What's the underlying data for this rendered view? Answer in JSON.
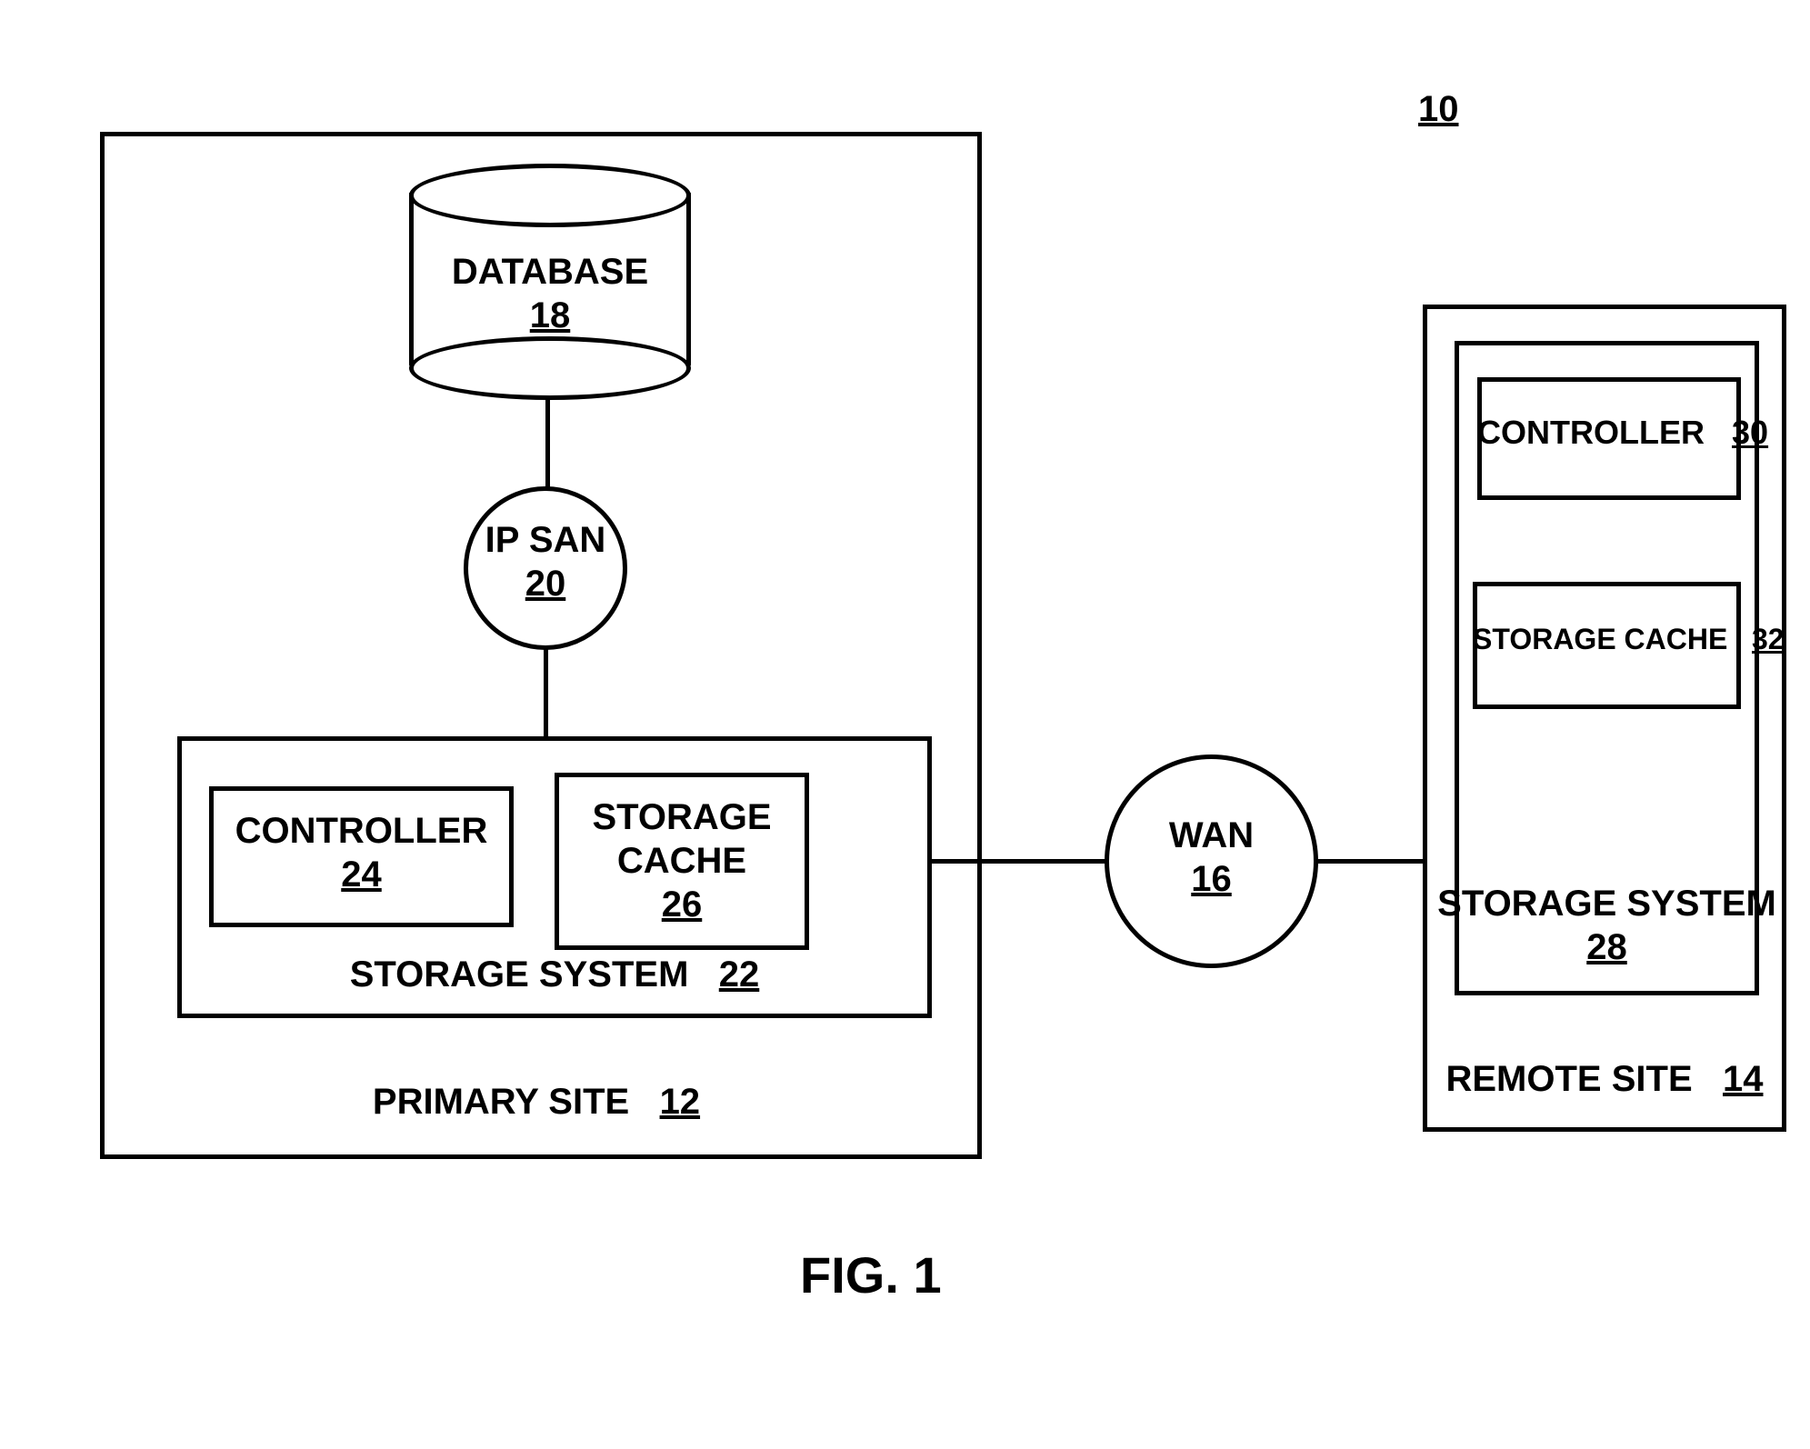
{
  "chart_data": {
    "type": "diagram",
    "title": "FIG. 1",
    "figure_number": "10",
    "nodes": [
      {
        "id": "10",
        "label": "10",
        "shape": "none"
      },
      {
        "id": "12",
        "label": "PRIMARY SITE",
        "number": "12",
        "shape": "rect"
      },
      {
        "id": "14",
        "label": "REMOTE SITE",
        "number": "14",
        "shape": "rect"
      },
      {
        "id": "16",
        "label": "WAN",
        "number": "16",
        "shape": "circle"
      },
      {
        "id": "18",
        "label": "DATABASE",
        "number": "18",
        "shape": "cylinder"
      },
      {
        "id": "20",
        "label": "IP SAN",
        "number": "20",
        "shape": "circle"
      },
      {
        "id": "22",
        "label": "STORAGE SYSTEM",
        "number": "22",
        "shape": "rect"
      },
      {
        "id": "24",
        "label": "CONTROLLER",
        "number": "24",
        "shape": "rect"
      },
      {
        "id": "26",
        "label": "STORAGE CACHE",
        "number": "26",
        "shape": "rect"
      },
      {
        "id": "28",
        "label": "STORAGE SYSTEM",
        "number": "28",
        "shape": "rect"
      },
      {
        "id": "30",
        "label": "CONTROLLER",
        "number": "30",
        "shape": "rect"
      },
      {
        "id": "32",
        "label": "STORAGE CACHE",
        "number": "32",
        "shape": "rect"
      }
    ],
    "edges": [
      {
        "from": "18",
        "to": "20"
      },
      {
        "from": "20",
        "to": "22"
      },
      {
        "from": "22",
        "to": "16"
      },
      {
        "from": "16",
        "to": "28"
      }
    ],
    "containment": {
      "12": [
        "18",
        "20",
        "22"
      ],
      "22": [
        "24",
        "26"
      ],
      "14": [
        "28"
      ],
      "28": [
        "30",
        "32"
      ]
    }
  },
  "figLabel": "FIG. 1",
  "figNum": "10",
  "primary": {
    "title": "PRIMARY SITE",
    "num": "12",
    "db": {
      "label": "DATABASE",
      "num": "18"
    },
    "ipsan": {
      "label": "IP SAN",
      "num": "20"
    },
    "storage": {
      "label": "STORAGE SYSTEM",
      "num": "22",
      "controller": {
        "label": "CONTROLLER",
        "num": "24"
      },
      "cache": {
        "label": "STORAGE",
        "label2": "CACHE",
        "num": "26"
      }
    }
  },
  "wan": {
    "label": "WAN",
    "num": "16"
  },
  "remote": {
    "title": "REMOTE SITE",
    "num": "14",
    "storage": {
      "label": "STORAGE SYSTEM",
      "num": "28",
      "controller": {
        "label": "CONTROLLER",
        "num": "30"
      },
      "cache": {
        "label": "STORAGE CACHE",
        "num": "32"
      }
    }
  }
}
